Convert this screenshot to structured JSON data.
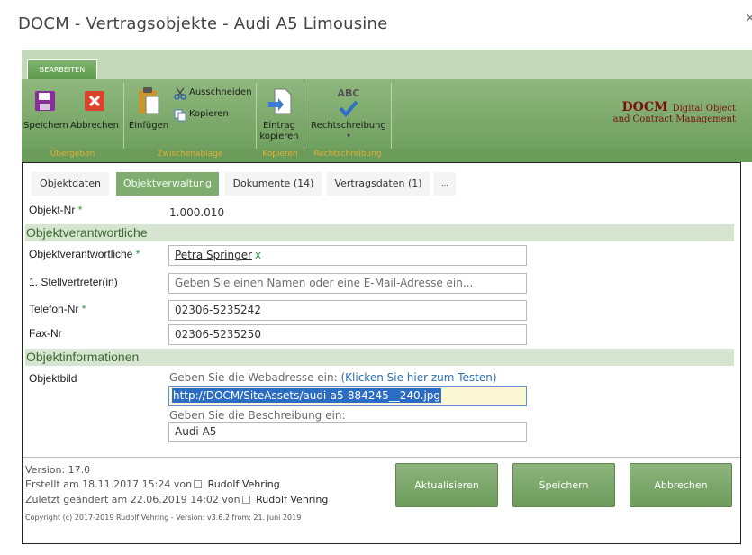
{
  "window": {
    "title": "DOCM - Vertragsobjekte - Audi A5 Limousine",
    "close_glyph": "×"
  },
  "ribbon": {
    "tab_label": "BEARBEITEN",
    "groups": {
      "uebergeben": {
        "caption": "Übergeben",
        "save": "Speichern",
        "cancel": "Abbrechen"
      },
      "zwischenablage": {
        "caption": "Zwischenablage",
        "paste": "Einfügen",
        "cut": "Ausschneiden",
        "copy": "Kopieren"
      },
      "kopieren": {
        "caption": "Kopieren",
        "entry_copy_line1": "Eintrag",
        "entry_copy_line2": "kopieren"
      },
      "rechtschreibung": {
        "caption": "Rechtschreibung",
        "spelling": "Rechtschreibung",
        "abc": "ABC",
        "dropdown": "▾"
      }
    },
    "logo": {
      "brand": "DOCM",
      "line1_rest": "Digital Object",
      "line2": "and Contract Management"
    },
    "icons": {
      "save": "floppy-disk-icon",
      "cancel": "close-x-icon",
      "paste": "clipboard-icon",
      "cut": "scissors-icon",
      "copy": "copy-icon",
      "entry_copy": "document-copy-icon",
      "spelling": "spellcheck-icon"
    }
  },
  "tabs": [
    "Objektdaten",
    "Objektverwaltung",
    "Dokumente (14)",
    "Vertragsdaten (1)",
    "..."
  ],
  "active_tab": "Objektverwaltung",
  "form": {
    "objekt_nr": {
      "label": "Objekt-Nr",
      "required": "*",
      "value": "1.000.010"
    },
    "section1": "Objektverantwortliche",
    "verantwortliche": {
      "label": "Objektverantwortliche",
      "required": "*",
      "person": "Petra Springer",
      "remove": "x"
    },
    "stellvertreter": {
      "label": "1. Stellvertreter(in)",
      "placeholder": "Geben Sie einen Namen oder eine E-Mail-Adresse ein..."
    },
    "telefon": {
      "label": "Telefon-Nr",
      "required": "*",
      "value": "02306-5235242"
    },
    "fax": {
      "label": "Fax-Nr",
      "value": "02306-5235250"
    },
    "section2": "Objektinformationen",
    "objektbild": {
      "label": "Objektbild",
      "url_hint": "Geben Sie die Webadresse ein:",
      "test_link": "(Klicken Sie hier zum Testen)",
      "url_value": "http://DOCM/SiteAssets/audi-a5-884245__240.jpg",
      "desc_hint": "Geben Sie die Beschreibung ein:",
      "desc_value": "Audi A5"
    }
  },
  "footer": {
    "version": "Version: 17.0",
    "created_prefix": "Erstellt am 18.11.2017 15:24",
    "modified_prefix": "Zuletzt geändert am 22.06.2019 14:02",
    "by": "von",
    "created_by": "Rudolf Vehring",
    "modified_by": "Rudolf Vehring",
    "copyright": "Copyright (c) 2017-2019 Rudolf Vehring - Version: v3.6.2 from: 21. Juni 2019",
    "btn_refresh": "Aktualisieren",
    "btn_save": "Speichern",
    "btn_cancel": "Abbrechen"
  },
  "colors": {
    "accent_green": "#7fac6f",
    "section_bg": "#d6e5d0",
    "section_text": "#3b6b31",
    "required": "#2e9a3e",
    "link": "#2a6fb6",
    "logo": "#7a0f0f"
  }
}
